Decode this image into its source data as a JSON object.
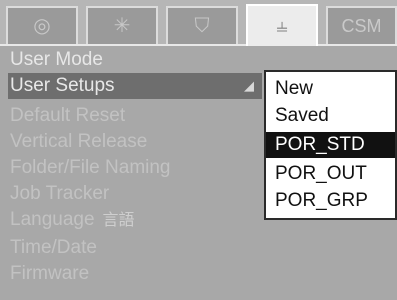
{
  "tabs": [
    {
      "icon": "circle-icon",
      "glyph": "◎"
    },
    {
      "icon": "sparkle-icon",
      "glyph": "✳"
    },
    {
      "icon": "shield-icon",
      "glyph": "⛉"
    },
    {
      "icon": "tools-icon",
      "glyph": "⫨",
      "active": true
    },
    {
      "label": "CSM"
    }
  ],
  "menu": {
    "items": [
      {
        "label": "User Mode"
      },
      {
        "label": "User Setups"
      },
      {
        "label": "Default Reset"
      },
      {
        "label": "Vertical Release"
      },
      {
        "label": "Folder/File Naming"
      },
      {
        "label": "Job Tracker"
      },
      {
        "label": "Language",
        "suffix": "言語"
      },
      {
        "label": "Time/Date"
      },
      {
        "label": "Firmware"
      }
    ],
    "selected_arrow": "◢"
  },
  "submenu": {
    "items": [
      {
        "label": "New"
      },
      {
        "label": "Saved"
      },
      {
        "label": "POR_STD"
      },
      {
        "label": "POR_OUT"
      },
      {
        "label": "POR_GRP"
      }
    ]
  }
}
